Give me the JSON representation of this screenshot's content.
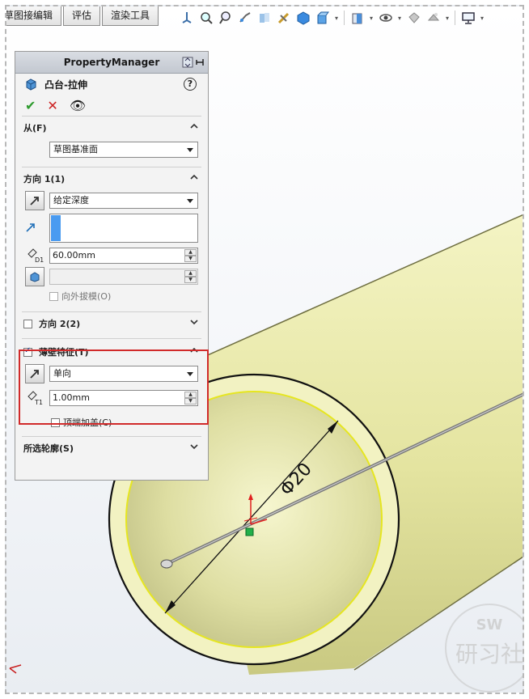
{
  "tabs": [
    "草图接编辑",
    "评估",
    "渲染工具"
  ],
  "toolbar_icons": [
    "view-orientation-icon",
    "zoom-fit-icon",
    "zoom-area-icon",
    "previous-view-icon",
    "section-view-icon",
    "dynamic-annotation-icon",
    "view-box-icon",
    "display-style-icon",
    "hide-show-icon",
    "edit-appearance-icon",
    "apply-scene-icon",
    "view-settings-icon"
  ],
  "pm": {
    "title": "PropertyManager",
    "feature_title": "凸台-拉伸",
    "help": "?",
    "from": {
      "label": "从(F)",
      "value": "草图基准面"
    },
    "direction1": {
      "label": "方向 1(1)",
      "end_condition": "给定深度",
      "depth": "60.00mm",
      "draft_value": "",
      "draft_outward": "向外拔模(O)"
    },
    "direction2": {
      "label": "方向 2(2)"
    },
    "thin": {
      "label": "薄壁特征(T)",
      "type": "单向",
      "thickness": "1.00mm",
      "cap_ends": "顶端加盖(C)"
    },
    "selected_contours": {
      "label": "所选轮廓(S)"
    }
  },
  "model": {
    "dimension": "Φ20",
    "colors": {
      "cylinder": "#efefb0",
      "edge": "#111111",
      "highlight": "#e6e620"
    }
  },
  "watermark": {
    "brand": "SW",
    "text": "研习社"
  }
}
